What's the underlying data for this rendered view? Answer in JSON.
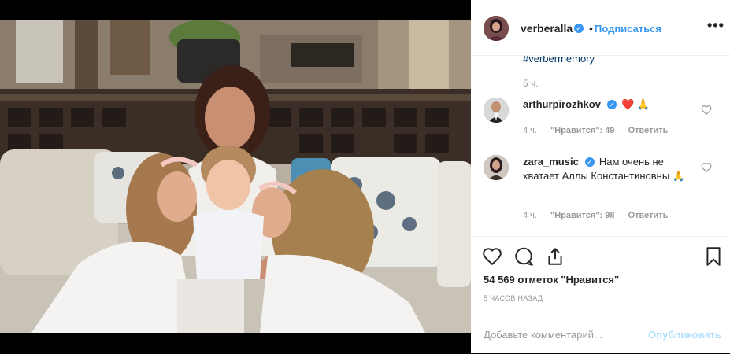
{
  "post": {
    "author": "verberalla",
    "follow_label": "Подписаться",
    "dot": "•",
    "more_label": "•••",
    "caption_tail": "#verbermemory",
    "caption_time": "5 ч."
  },
  "comments": [
    {
      "author": "arthurpirozhkov",
      "text": "❤️ 🙏",
      "time": "4 ч.",
      "likes": "\"Нравится\": 49",
      "reply": "Ответить"
    },
    {
      "author": "zara_music",
      "text": "Нам очень не хватает Аллы Константиновны 🙏",
      "time": "4 ч.",
      "likes": "\"Нравится\": 98",
      "reply": "Ответить"
    }
  ],
  "actions": {
    "icons": [
      "heart-icon",
      "comment-icon",
      "share-icon",
      "bookmark-icon"
    ],
    "likes_text": "54 569 отметок \"Нравится\"",
    "ago_text": "5 ЧАСОВ НАЗАД"
  },
  "add_comment": {
    "placeholder": "Добавьте комментарий...",
    "publish_label": "Опубликовать"
  },
  "colors": {
    "accent": "#3897f0",
    "publish_disabled": "#b2dffc",
    "muted": "#999999",
    "hashtag": "#003569"
  }
}
